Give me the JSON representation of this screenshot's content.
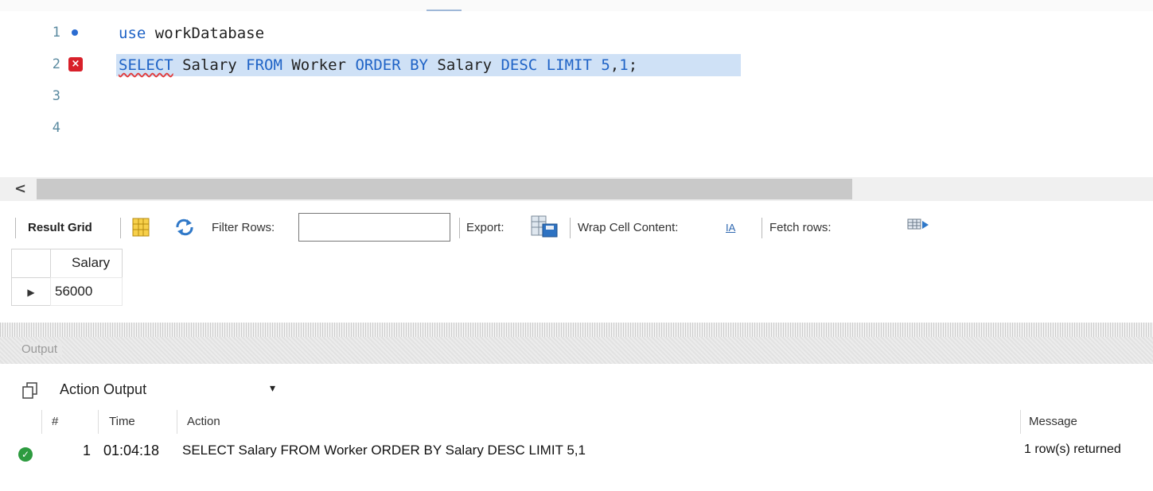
{
  "editor": {
    "lines": [
      {
        "num": "1"
      },
      {
        "num": "2"
      },
      {
        "num": "3"
      },
      {
        "num": "4"
      }
    ],
    "line1": {
      "kw_use": "use",
      "db": " workDatabase"
    },
    "line2": {
      "t1": "SELECT",
      "t2": " Salary ",
      "t3": "FROM",
      "t4": " Worker ",
      "t5": "ORDER BY",
      "t6": " Salary ",
      "t7": "DESC",
      "t8": " ",
      "t9": "LIMIT",
      "t10": " ",
      "t11": "5",
      "t12": ",",
      "t13": "1",
      "t14": ";"
    },
    "error_marker": "×"
  },
  "scrollbar": {
    "left_arrow": "<"
  },
  "result_toolbar": {
    "result_grid": "Result Grid",
    "filter_rows": "Filter Rows:",
    "filter_value": "",
    "export": "Export:",
    "wrap_cell": "Wrap Cell Content:",
    "wrap_icon_text": "IA",
    "fetch_rows": "Fetch rows:"
  },
  "grid": {
    "column": "Salary",
    "rows": [
      {
        "indicator": "▶",
        "salary": "56000"
      }
    ]
  },
  "output": {
    "header": "Output",
    "selector": "Action Output",
    "columns": {
      "num": "#",
      "time": "Time",
      "action": "Action",
      "message": "Message"
    },
    "rows": [
      {
        "num": "1",
        "time": "01:04:18",
        "action": "SELECT Salary FROM Worker ORDER BY Salary DESC LIMIT 5,1",
        "message": "1 row(s) returned",
        "status": "success"
      }
    ]
  },
  "colors": {
    "keyword": "#1f63c6",
    "selection": "#cfe1f6",
    "error": "#d8202a",
    "success": "#2d9b3f"
  }
}
